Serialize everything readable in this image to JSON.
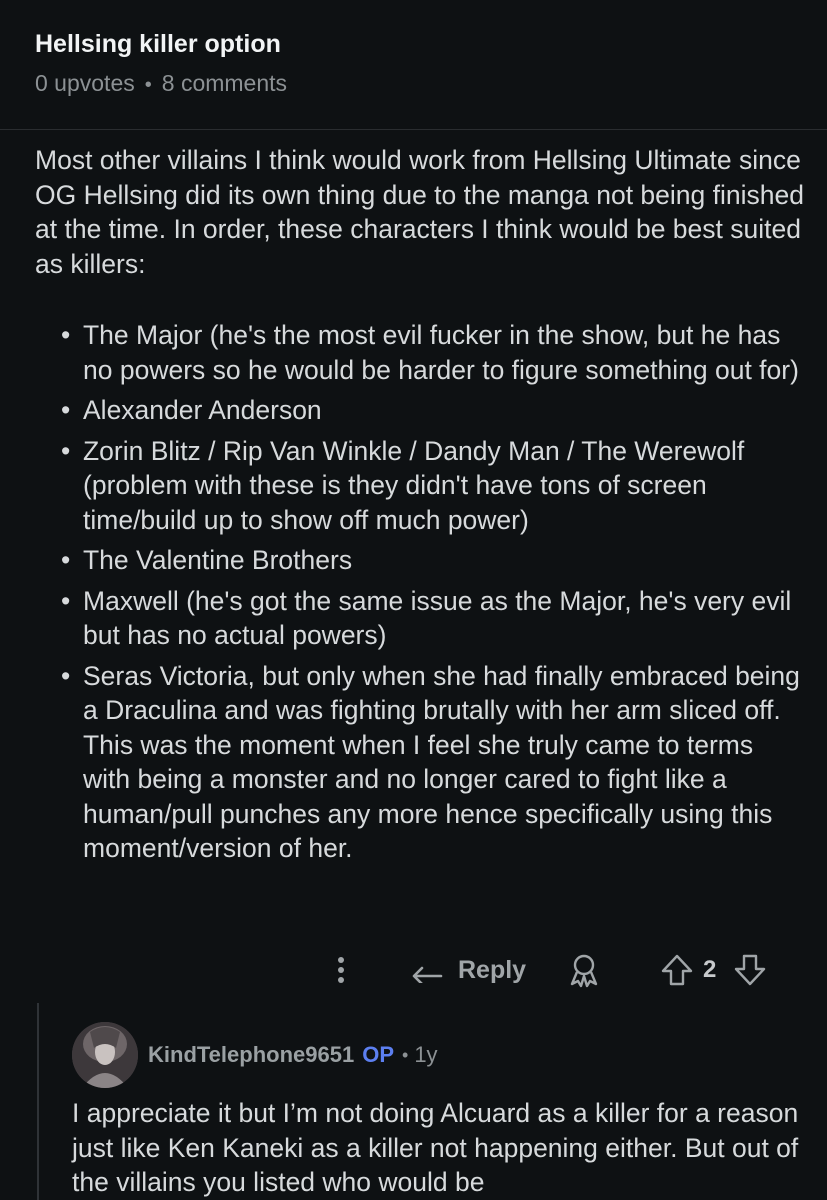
{
  "post": {
    "title": "Hellsing killer option",
    "upvotes": "0 upvotes",
    "separator": "•",
    "comments": "8 comments"
  },
  "comment": {
    "intro": "Most other villains I think would work from Hellsing Ultimate since OG Hellsing did its own thing due to the manga not being finished at the time. In order, these characters I think would be best suited as killers:",
    "items": [
      "The Major (he's the most evil fucker in the show, but he has no powers so he would be harder to figure something out for)",
      "Alexander Anderson",
      "Zorin Blitz / Rip Van Winkle / Dandy Man / The Werewolf (problem with these is they didn't have tons of screen time/build up to show off much power)",
      "The Valentine Brothers",
      "Maxwell (he's got the same issue as the Major, he's very evil but has no actual powers)",
      "Seras Victoria, but only when she had finally embraced being a Draculina and was fighting brutally with her arm sliced off. This was the moment when I feel she truly came to terms with being a monster and no longer cared to fight like a human/pull punches any more hence specifically using this moment/version of her."
    ],
    "actions": {
      "more_icon": "more-vertical-icon",
      "reply_label": "Reply",
      "award_icon": "award-icon",
      "upvote_icon": "upvote-arrow-icon",
      "score": "2",
      "downvote_icon": "downvote-arrow-icon"
    }
  },
  "reply": {
    "username": "KindTelephone9651",
    "badge": "OP",
    "separator": "•",
    "time": "1y",
    "text": "I appreciate it but I’m not doing Alcuard as a killer for a reason just like Ken Kaneki as a killer not happening either. But out of the villains you listed who would be"
  },
  "colors": {
    "background": "#0e1113",
    "text": "#d7dadc",
    "muted": "#8c9194",
    "op_badge": "#5c7ff0"
  }
}
